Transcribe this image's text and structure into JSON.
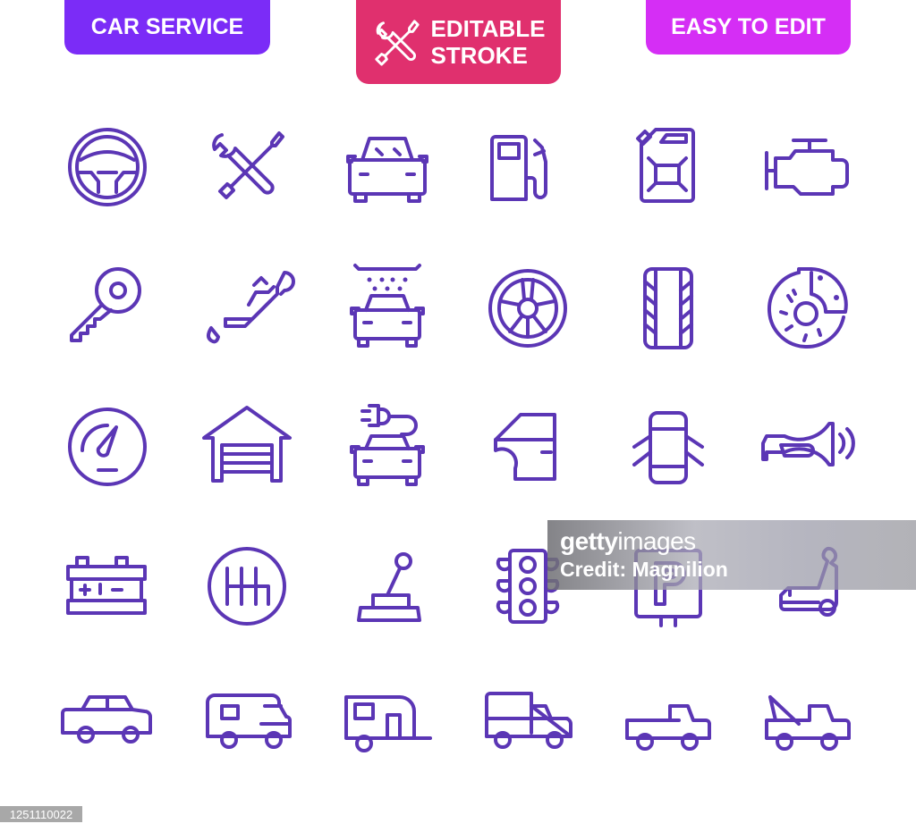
{
  "badges": [
    {
      "label": "CAR SERVICE",
      "color": "#7b2cf7"
    },
    {
      "label_line1": "EDITABLE",
      "label_line2": "STROKE",
      "icon": "wrench-screwdriver-icon",
      "color": "#e0306e"
    },
    {
      "label": "EASY TO EDIT",
      "color": "#d52ef5"
    }
  ],
  "icon_color": "#5b36b5",
  "icons": [
    [
      "steering-wheel",
      "wrench-screwdriver",
      "car-front",
      "fuel-pump",
      "jerrycan",
      "engine"
    ],
    [
      "car-key",
      "oil-can",
      "car-wash",
      "wheel-rim",
      "tire-tread",
      "disc-brake"
    ],
    [
      "speedometer",
      "garage",
      "electric-car",
      "car-door",
      "car-doors-open",
      "car-horn"
    ],
    [
      "car-battery",
      "manual-gearbox",
      "gear-shift-lever",
      "traffic-light",
      "parking-sign",
      "car-seat"
    ],
    [
      "sedan",
      "camper-van",
      "caravan-trailer",
      "delivery-truck",
      "pickup-truck",
      "tow-truck"
    ]
  ],
  "watermark": {
    "brand_bold": "getty",
    "brand_light": "images",
    "credit": "Credit: Magnilion"
  },
  "image_id": "1251110022"
}
